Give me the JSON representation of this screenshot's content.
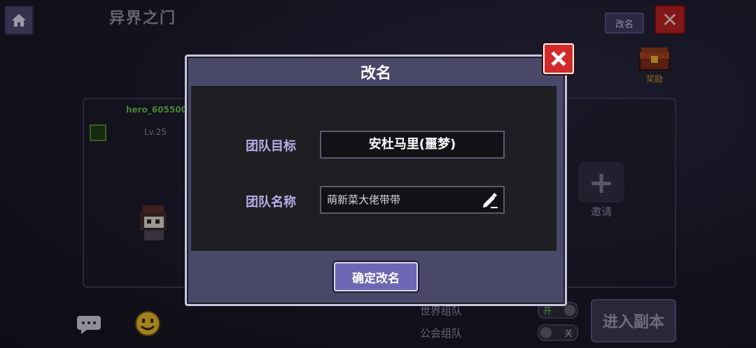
{
  "header": {
    "title": "异界之门",
    "rename_button": "改名",
    "home_icon": "home-icon",
    "close_icon": "close-icon"
  },
  "team": {
    "hero_name": "hero_605500",
    "hero_level": "Lv.25"
  },
  "reward": {
    "label": "奖励",
    "icon": "treasure-chest-icon"
  },
  "invite": {
    "label": "邀请",
    "icon": "plus-icon"
  },
  "matching": {
    "world": {
      "label": "世界组队",
      "state": "开"
    },
    "guild": {
      "label": "公会组队",
      "state": "关"
    }
  },
  "enter_button": "进入副本",
  "dialog": {
    "title": "改名",
    "goal_label": "团队目标",
    "goal_value": "安杜马里(噩梦)",
    "name_label": "团队名称",
    "name_value": "萌新菜大佬带带",
    "confirm_button": "确定改名"
  },
  "colors": {
    "dialog_bg": "#4a4868",
    "label_purple": "#b4b0e8",
    "close_red": "#d42a2a",
    "confirm_button": "#6e68b4"
  }
}
